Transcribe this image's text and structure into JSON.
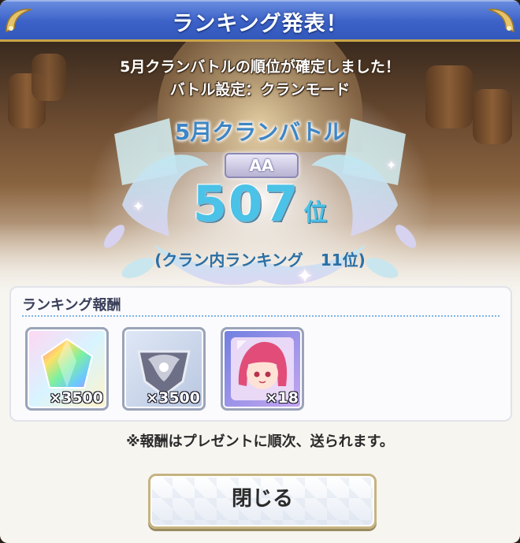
{
  "dialog": {
    "title": "ランキング発表！",
    "confirm_line1": "5月クランバトルの順位が確定しました！",
    "confirm_line2": "バトル設定：クランモード"
  },
  "result": {
    "battle_name": "5月クランバトル",
    "grade": "AA",
    "rank": "507",
    "rank_unit": "位",
    "clan_rank_label": "(クラン内ランキング",
    "clan_rank_value": "11位)"
  },
  "rewards": {
    "title": "ランキング報酬",
    "items": [
      {
        "icon": "rainbow-crystal-icon",
        "qty": "×3500"
      },
      {
        "icon": "silver-crest-icon",
        "qty": "×3500"
      },
      {
        "icon": "character-memory-piece-icon",
        "qty": "×18"
      }
    ]
  },
  "note": "※報酬はプレゼントに順次、送られます。",
  "close_button": "閉じる",
  "colors": {
    "title_bar": "#3c62c8",
    "rank_text": "#4bc2e7",
    "accent_blue": "#2b6fa5",
    "gold_border": "#c6b381"
  }
}
